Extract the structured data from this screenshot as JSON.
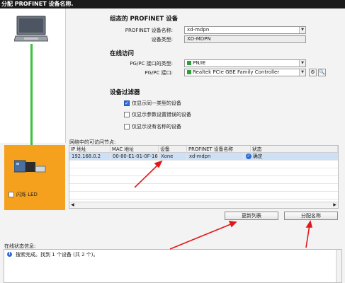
{
  "window": {
    "title": "分配 PROFINET 设备名称."
  },
  "left": {
    "flash_led_label": "闪烁 LED"
  },
  "configured_device": {
    "section_title": "组态的 PROFINET 设备",
    "name_label": "PROFINET 设备名称:",
    "name_value": "xd-mdpn",
    "type_label": "设备类型:",
    "type_value": "XD-MDPN"
  },
  "online_access": {
    "section_title": "在线访问",
    "interface_type_label": "PG/PC 接口的类型:",
    "interface_type_value": "PN/IE",
    "interface_label": "PG/PC 接口:",
    "interface_value": "Realtek PCIe GBE Family Controller"
  },
  "device_filter": {
    "section_title": "设备过滤器",
    "options": [
      {
        "label": "仅显示同一类型的设备",
        "checked": true
      },
      {
        "label": "仅显示参数设置错误的设备",
        "checked": false
      },
      {
        "label": "仅显示没有名称的设备",
        "checked": false
      }
    ]
  },
  "table": {
    "title": "网络中的可访问节点:",
    "columns": [
      "IP 地址",
      "MAC 地址",
      "设备",
      "PROFINET 设备名称",
      "状态"
    ],
    "rows": [
      {
        "ip": "192.168.0.2",
        "mac": "00-80-E1-01-0F-16",
        "device": "Xone",
        "name": "xd-mdpn",
        "status": "确定"
      }
    ]
  },
  "buttons": {
    "refresh": "更新列表",
    "assign": "分配名称"
  },
  "status": {
    "label": "在线状态信息:",
    "message": "搜索完成。找到 1 个设备 (共 2 个)。"
  },
  "colors": {
    "device_box": "#f6a11d",
    "link_line": "#3cc13c",
    "arrow": "#e01818",
    "selected_row": "#cde0f5"
  }
}
